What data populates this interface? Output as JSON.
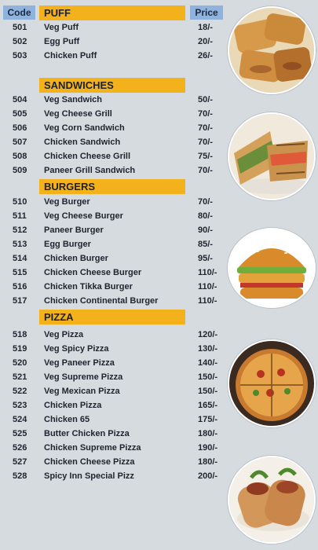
{
  "header": {
    "code_label": "Code",
    "price_label": "Price"
  },
  "sections": {
    "puff": "PUFF",
    "sandwiches": "SANDWICHES",
    "burgers": "BURGERS",
    "pizza": "PIZZA"
  },
  "items": [
    {
      "code": "501",
      "name": "Veg Puff",
      "price": "18/-"
    },
    {
      "code": "502",
      "name": "Egg Puff",
      "price": "20/-"
    },
    {
      "code": "503",
      "name": "Chicken Puff",
      "price": "26/-"
    },
    {
      "code": "504",
      "name": "Veg Sandwich",
      "price": "50/-"
    },
    {
      "code": "505",
      "name": "Veg Cheese Grill",
      "price": "70/-"
    },
    {
      "code": "506",
      "name": "Veg Corn Sandwich",
      "price": "70/-"
    },
    {
      "code": "507",
      "name": "Chicken Sandwich",
      "price": "70/-"
    },
    {
      "code": "508",
      "name": "Chicken Cheese Grill",
      "price": "75/-"
    },
    {
      "code": "509",
      "name": "Paneer Grill Sandwich",
      "price": "70/-"
    },
    {
      "code": "510",
      "name": "Veg Burger",
      "price": "70/-"
    },
    {
      "code": "511",
      "name": "Veg Cheese Burger",
      "price": "80/-"
    },
    {
      "code": "512",
      "name": "Paneer Burger",
      "price": "90/-"
    },
    {
      "code": "513",
      "name": "Egg Burger",
      "price": "85/-"
    },
    {
      "code": "514",
      "name": "Chicken Burger",
      "price": "95/-"
    },
    {
      "code": "515",
      "name": "Chicken Cheese Burger",
      "price": "110/-"
    },
    {
      "code": "516",
      "name": "Chicken Tikka Burger",
      "price": "110/-"
    },
    {
      "code": "517",
      "name": "Chicken Continental Burger",
      "price": "110/-"
    },
    {
      "code": "518",
      "name": "Veg Pizza",
      "price": "120/-"
    },
    {
      "code": "519",
      "name": "Veg Spicy Pizza",
      "price": "130/-"
    },
    {
      "code": "520",
      "name": "Veg Paneer Pizza",
      "price": "140/-"
    },
    {
      "code": "521",
      "name": "Veg Supreme Pizza",
      "price": "150/-"
    },
    {
      "code": "522",
      "name": "Veg Mexican Pizza",
      "price": "150/-"
    },
    {
      "code": "523",
      "name": "Chicken Pizza",
      "price": "165/-"
    },
    {
      "code": "524",
      "name": "Chicken 65",
      "price": "175/-"
    },
    {
      "code": "525",
      "name": "Butter Chicken Pizza",
      "price": "180/-"
    },
    {
      "code": "526",
      "name": "Chicken Supreme Pizza",
      "price": "190/-"
    },
    {
      "code": "527",
      "name": "Chicken Cheese Pizza",
      "price": "180/-"
    },
    {
      "code": "528",
      "name": "Spicy Inn Special Pizz",
      "price": "200/-"
    }
  ],
  "colors": {
    "header_bg": "#8fb3dd",
    "section_bg": "#f3b21b",
    "page_bg": "#d6dbe0"
  },
  "images": [
    "puff-photo",
    "sandwich-photo",
    "burger-photo",
    "pizza-photo",
    "wrap-photo"
  ]
}
